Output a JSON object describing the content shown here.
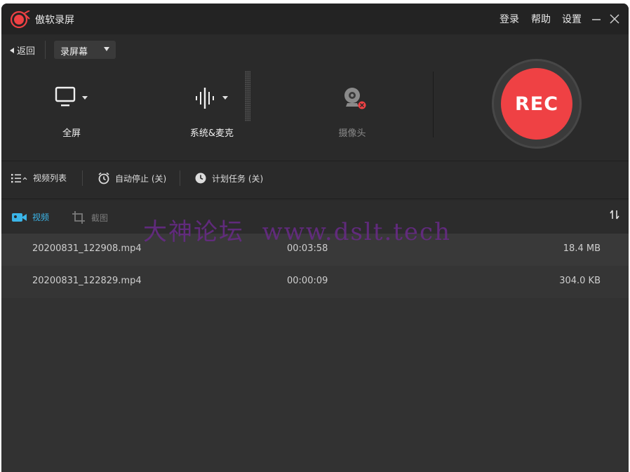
{
  "titlebar": {
    "app_title": "傲软录屏",
    "login": "登录",
    "help": "帮助",
    "settings": "设置"
  },
  "controls": {
    "back_label": "返回",
    "mode_label": "录屏幕",
    "sources": [
      {
        "label": "全屏",
        "icon": "monitor-icon"
      },
      {
        "label": "系统&麦克",
        "icon": "audio-wave-icon"
      },
      {
        "label": "摄像头",
        "icon": "webcam-icon"
      }
    ],
    "rec_label": "REC"
  },
  "toolbar": {
    "video_list": "视频列表",
    "auto_stop": "自动停止 (关)",
    "schedule": "计划任务 (关)"
  },
  "tabs": {
    "video": "视频",
    "screenshot": "截图"
  },
  "files": [
    {
      "name": "20200831_122908.mp4",
      "duration": "00:03:58",
      "size": "18.4 MB"
    },
    {
      "name": "20200831_122829.mp4",
      "duration": "00:00:09",
      "size": "304.0 KB"
    }
  ],
  "watermark": "大神论坛  www.dslt.tech",
  "colors": {
    "accent_red": "#ef4144",
    "tab_active": "#3bb5e8",
    "window_bg": "#2a2a2a"
  }
}
